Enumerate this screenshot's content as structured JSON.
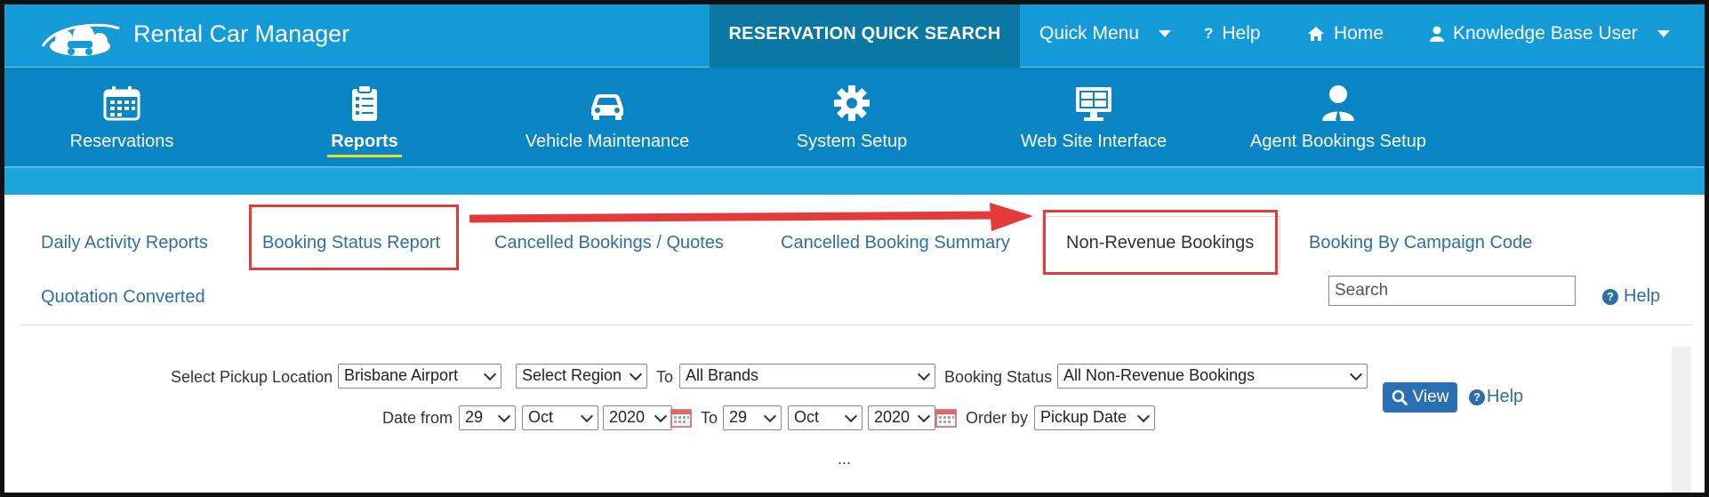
{
  "topbar": {
    "brand_title": "Rental Car Manager",
    "quick_search": "RESERVATION QUICK SEARCH",
    "quick_menu": "Quick Menu",
    "help": "Help",
    "home": "Home",
    "user": "Knowledge Base User"
  },
  "modules": [
    {
      "label": "Reservations",
      "icon": "calendar-icon"
    },
    {
      "label": "Reports",
      "icon": "clipboard-icon",
      "active": true
    },
    {
      "label": "Vehicle Maintenance",
      "icon": "car-icon"
    },
    {
      "label": "System Setup",
      "icon": "gear-icon"
    },
    {
      "label": "Web Site Interface",
      "icon": "monitor-icon"
    },
    {
      "label": "Agent Bookings Setup",
      "icon": "agent-icon"
    }
  ],
  "tabs": [
    "Daily Activity Reports",
    "Booking Status Report",
    "Cancelled Bookings / Quotes",
    "Cancelled Booking Summary",
    "Non-Revenue Bookings",
    "Booking By Campaign Code",
    "Quotation Converted"
  ],
  "active_tab": "Non-Revenue Bookings",
  "search": {
    "placeholder": "Search"
  },
  "help_link": "Help",
  "form": {
    "pickup_label": "Select Pickup Location",
    "pickup_value": "Brisbane Airport",
    "region_value": "Select Region",
    "to_label": "To",
    "brands_value": "All Brands",
    "status_label": "Booking Status",
    "status_value": "All Non-Revenue Bookings",
    "date_from_label": "Date from",
    "from_day": "29",
    "from_month": "Oct",
    "from_year": "2020",
    "date_to_label": "To",
    "to_day": "29",
    "to_month": "Oct",
    "to_year": "2020",
    "order_label": "Order by",
    "order_value": "Pickup Date",
    "view_button": "View",
    "help": "Help",
    "ellipsis": "..."
  },
  "colors": {
    "topbar": "#159ad8",
    "quick_search_bg": "#0a78a2",
    "modulebar": "#0a85c3",
    "link": "#2d6ea8",
    "annotation_red": "#e33a3a"
  }
}
